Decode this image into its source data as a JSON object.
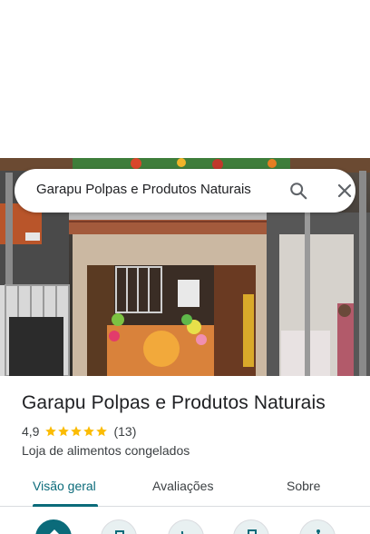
{
  "search": {
    "query": "Garapu Polpas e Produtos Naturais"
  },
  "place": {
    "name": "Garapu Polpas e Produtos Naturais",
    "rating": "4,9",
    "stars": 5,
    "review_count": "(13)",
    "category": "Loja de alimentos congelados"
  },
  "tabs": [
    {
      "label": "Visão geral",
      "active": true
    },
    {
      "label": "Avaliações",
      "active": false
    },
    {
      "label": "Sobre",
      "active": false
    }
  ],
  "actions": [
    {
      "icon": "directions-icon"
    },
    {
      "icon": "start-icon"
    },
    {
      "icon": "call-icon"
    },
    {
      "icon": "save-icon"
    },
    {
      "icon": "share-icon"
    }
  ],
  "colors": {
    "accent": "#0b6b7a",
    "star": "#fbbc04",
    "text": "#202124"
  }
}
